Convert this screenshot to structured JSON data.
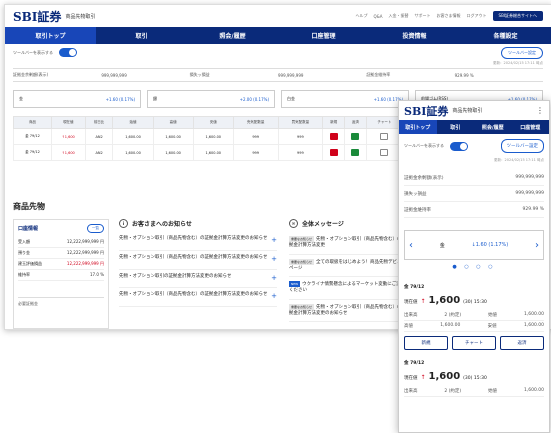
{
  "brand": {
    "logo": "SBI証券",
    "sub": "商品先物取引"
  },
  "toplinks": [
    "ヘルプ",
    "Q&A",
    "入金・振替",
    "サポート",
    "お客さま情報",
    "ログアウト"
  ],
  "toplink_button": "SBI証券総合サイトへ",
  "nav": [
    "取引トップ",
    "取引",
    "照会/履歴",
    "口座管理",
    "投資情報",
    "各種設定"
  ],
  "toolbar": {
    "toggle_label": "ツールバーを表示する",
    "tool_button": "ツールバー設定",
    "updated": "更新：2024/02/15 17:11 時点"
  },
  "summary": [
    "証拠金余剰額(表示)",
    "999,999,999",
    "損失ッ損益",
    "999,999,999",
    "証拠金維持率",
    "929.99 %"
  ],
  "tickers": [
    {
      "name": "金",
      "value": "+1.60 (0.17%)"
    },
    {
      "name": "銀",
      "value": "+2.00 (0.17%)"
    },
    {
      "name": "白金",
      "value": "+1.60 (0.17%)"
    },
    {
      "name": "前場ゴム(RSS)",
      "value": "+1.60 (0.17%)"
    }
  ],
  "table": {
    "headers": [
      "商品",
      "現在値",
      "前日比",
      "始値",
      "高値",
      "安値",
      "売気配数量",
      "買気配数量",
      "新規",
      "返済",
      "チャート"
    ],
    "rows": [
      {
        "name": "金 79/12",
        "price": "↑1,600",
        "diff": "AN2",
        "open": "1,600.00",
        "high": "1,600.00",
        "low": "1,600.00",
        "sell": "999",
        "buy": "999"
      },
      {
        "name": "金 79/12",
        "price": "↑1,600",
        "diff": "AN2",
        "open": "1,600.00",
        "high": "1,600.00",
        "low": "1,600.00",
        "sell": "999",
        "buy": "999"
      }
    ]
  },
  "section_title": "商品先物",
  "account": {
    "title": "口座情報",
    "button": "一覧",
    "rows": [
      {
        "label": "受入額",
        "value": "12,222,999,999 円",
        "red": false
      },
      {
        "label": "預り金",
        "value": "12,222,999,999 円",
        "red": false
      },
      {
        "label": "建玉評価損益",
        "value": "12,222,999,999 円",
        "red": true
      },
      {
        "label": "維持率",
        "value": "17.0 %",
        "red": false
      }
    ],
    "footer": "必要証拠金"
  },
  "news": {
    "title": "お客さまへのお知らせ",
    "items": [
      "先物・オプション取引（商品先物含む）の証拠金計算方法変更のお知らせ",
      "先物・オプション取引（商品先物含む）の証拠金計算方法変更のお知らせ",
      "先物・オプション取引の証拠金計算方法変更のお知らせ",
      "先物・オプション取引（商品先物含む）の証拠金計算方法変更のお知らせ"
    ]
  },
  "messages": {
    "title": "全体メッセージ",
    "items": [
      {
        "tag": "重要なお知らせ",
        "text": "先物・オプション取引（商品先物含む）の証拠金計算方法変更"
      },
      {
        "tag": "重要なお知らせ",
        "text": "全ての取扱をはじめよう！商品先物デビューページ"
      },
      {
        "tag": "NEW",
        "text": "ウクライナ情勢懸念によるマーケット変動にご注意ください"
      },
      {
        "tag": "重要なお知らせ",
        "text": "先物・オプション取引（商品先物含む）の証拠金計算方法変更のお知らせ"
      }
    ]
  },
  "mobile": {
    "nav": [
      "取引トップ",
      "取引",
      "照会/履歴",
      "口座管理"
    ],
    "toggle_label": "ツールバーを表示する",
    "tool_button": "ツールバー設定",
    "updated": "更新：2024/02/15 17:11 時点",
    "stats": [
      {
        "label": "証拠金余剰額(表示)",
        "value": "999,999,999"
      },
      {
        "label": "損失ッ損益",
        "value": "999,999,999"
      },
      {
        "label": "証拠金維持率",
        "value": "929.99 %"
      }
    ],
    "carousel": {
      "name": "金",
      "value": "↓1.60 (1.17%)"
    },
    "products": [
      {
        "title": "金 79/12",
        "label": "現在値",
        "price": "1,600",
        "sub": "(30) 15:30",
        "g1l": "出来高",
        "g1v": "2 (約定)",
        "g2l": "始値",
        "g2v": "1,600.00",
        "g3l": "高値",
        "g3v": "1,600.00",
        "g4l": "安値",
        "g4v": "1,600.00"
      },
      {
        "title": "金 79/12",
        "label": "現在値",
        "price": "1,600",
        "sub": "(30) 15:30",
        "g1l": "出来高",
        "g1v": "2 (約定)",
        "g2l": "始値",
        "g2v": "1,600.00"
      }
    ],
    "buttons": [
      "新規",
      "チャート",
      "返済"
    ]
  }
}
